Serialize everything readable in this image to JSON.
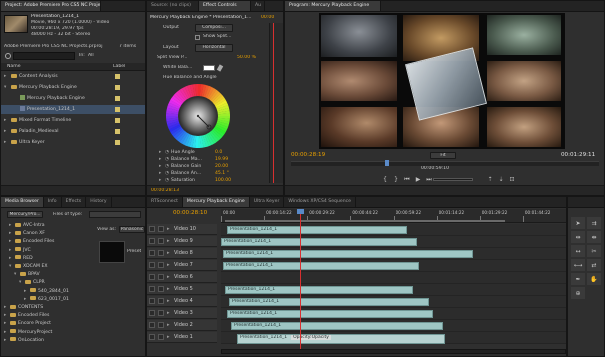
{
  "project": {
    "tabs": [
      "Project: Adobe Premiere Pro CS5 NC Projects",
      "Source: (no clips)",
      "Effect Controls",
      "Au"
    ],
    "clip_name": "Presentation_1214_1",
    "clip_info": [
      "Movie, 960 x 720 (1.0000) - Video",
      "00:00:28:19, 29.97 fps",
      "48000 Hz - 32 bit - Stereo"
    ],
    "project_file": "Adobe Premiere Pro CS5 NC Projects.prproj",
    "items_count": "7 items",
    "in_label": "In:",
    "in_value": "All",
    "col_name": "Name",
    "col_label": "Label",
    "items": [
      {
        "name": "Content Analysis",
        "type": "folder",
        "color": "#d6c26a"
      },
      {
        "name": "Mercury Playback Engine",
        "type": "folder-open",
        "color": "#d6c26a"
      },
      {
        "name": "Mercury Playback Engine",
        "type": "seq",
        "color": "#d6c26a"
      },
      {
        "name": "Presentation_1214_1",
        "type": "clip",
        "color": "#d6c26a",
        "selected": true
      },
      {
        "name": "Mixed Format Timeline",
        "type": "folder",
        "color": "#d6c26a"
      },
      {
        "name": "Paladin_Medieval",
        "type": "folder",
        "color": "#d6c26a"
      },
      {
        "name": "Ultra Keyer",
        "type": "folder",
        "color": "#d6c26a"
      }
    ]
  },
  "effects": {
    "header": "Mercury Playback Engine * Presentation_1...",
    "timecode": "00:00",
    "output_label": "Output",
    "output_value": "Composi...",
    "show_split": "Show Split...",
    "layout_label": "Layout",
    "layout_value": "Horizontal",
    "split_view": "Split View P...",
    "split_value": "50.00 %",
    "white_bal": "White Bala...",
    "section": "Hue Balance and Angle",
    "params": [
      {
        "name": "Hue Angle",
        "value": "0.0"
      },
      {
        "name": "Balance Ma...",
        "value": "19.99"
      },
      {
        "name": "Balance Gain",
        "value": "20.00"
      },
      {
        "name": "Balance An...",
        "value": "45.1 °"
      },
      {
        "name": "Saturation",
        "value": "100.00"
      }
    ],
    "bottom_tc": "00:00:28:13"
  },
  "program": {
    "title": "Program: Mercury Playback Engine",
    "timecode": "00:00:28:19",
    "fit": "Fit",
    "duration_mid": "00:00:59:10",
    "duration": "00:01:29:11"
  },
  "media_browser": {
    "tabs": [
      "Media Browser",
      "Info",
      "Effects",
      "History"
    ],
    "dropdown": "Mercury/Pro...",
    "files_of_type": "Files of type:",
    "view_as": "View as:",
    "panasonic": "Panasonic",
    "preset": "Preset",
    "tree": [
      {
        "name": "AVC-Intra",
        "indent": 1
      },
      {
        "name": "Canon XF",
        "indent": 1
      },
      {
        "name": "Encoded Files",
        "indent": 1
      },
      {
        "name": "JVC",
        "indent": 1
      },
      {
        "name": "RED",
        "indent": 1
      },
      {
        "name": "XDCAM EX",
        "indent": 1,
        "open": true
      },
      {
        "name": "BPAV",
        "indent": 2,
        "open": true
      },
      {
        "name": "CLPR",
        "indent": 3,
        "open": true
      },
      {
        "name": "540_2844_01",
        "indent": 4
      },
      {
        "name": "623_0017_01",
        "indent": 4
      },
      {
        "name": "CONTENTS",
        "indent": 0
      },
      {
        "name": "Encoded Files",
        "indent": 0
      },
      {
        "name": "Encore Project",
        "indent": 0
      },
      {
        "name": "MercuryProject",
        "indent": 0
      },
      {
        "name": "OnLocation",
        "indent": 0
      }
    ]
  },
  "timeline": {
    "tabs": [
      "RTSconnect",
      "Mercury Playback Engine",
      "Ultra Keyer",
      "Windows XP/CS4 Sequence"
    ],
    "timecode": "00:00:28:10",
    "ruler": [
      "00:00",
      "00:00:14:22",
      "00:00:29:22",
      "00:00:44:22",
      "00:00:59:22",
      "00:01:14:22",
      "00:01:29:22",
      "00:01:44:22"
    ],
    "tracks": [
      "Video 10",
      "Video 9",
      "Video 8",
      "Video 7",
      "Video 6",
      "Video 5",
      "Video 4",
      "Video 3",
      "Video 2",
      "Video 1"
    ],
    "clips": [
      {
        "track": 0,
        "label": "Presentation_1214_1"
      },
      {
        "track": 1,
        "label": "Presentation_1214_1"
      },
      {
        "track": 2,
        "label": "Presentation_1214_1"
      },
      {
        "track": 3,
        "label": "Presentation_1214_1"
      },
      {
        "track": 5,
        "label": "Presentation_1214_1"
      },
      {
        "track": 6,
        "label": "Presentation_1214_1"
      },
      {
        "track": 7,
        "label": "Presentation_1214_1"
      },
      {
        "track": 8,
        "label": "Presentation_1214_1"
      },
      {
        "track": 9,
        "label": "Presentation_1214_1",
        "extra": "Opacity:Opacity"
      }
    ]
  },
  "colors": {
    "accent": "#e8a000",
    "clip": "#9ec6c4",
    "playhead": "#d83030",
    "link": "#6fa8e0"
  }
}
